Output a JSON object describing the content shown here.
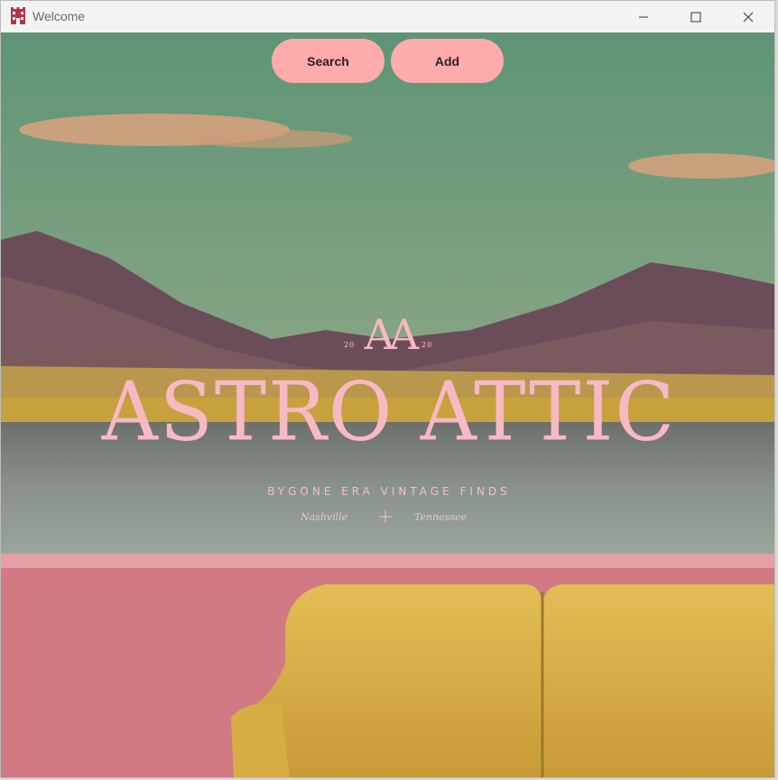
{
  "window": {
    "title": "Welcome",
    "app_icon": "castle-app-icon",
    "controls": [
      "minimize-icon",
      "maximize-icon",
      "close-icon"
    ]
  },
  "toolbar": {
    "search_label": "Search",
    "add_label": "Add",
    "button_color": "#fdabab"
  },
  "brand": {
    "monogram": "AA",
    "year_left": "20",
    "year_right": "20",
    "name": "ASTRO ATTIC",
    "tagline": "BYGONE ERA VINTAGE FINDS",
    "city": "Nashville",
    "state": "Tennessee",
    "text_color": "#f7b9c4"
  },
  "colors": {
    "sky": "#6e9a7a",
    "mountains": "#6a4a55",
    "lake": "#7f8a83",
    "wall": "#d07880",
    "sofa": "#d9b34a"
  }
}
